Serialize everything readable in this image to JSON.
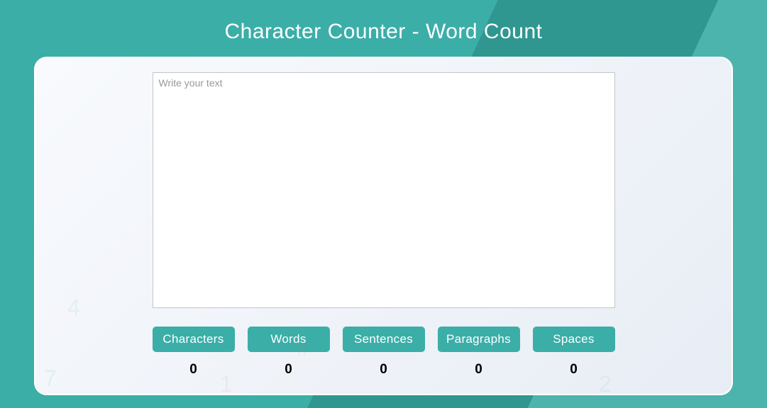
{
  "header": {
    "title": "Character Counter - Word Count"
  },
  "input": {
    "value": "",
    "placeholder": "Write your text"
  },
  "counters": [
    {
      "label": "Characters",
      "value": "0"
    },
    {
      "label": "Words",
      "value": "0"
    },
    {
      "label": "Sentences",
      "value": "0"
    },
    {
      "label": "Paragraphs",
      "value": "0"
    },
    {
      "label": "Spaces",
      "value": "0"
    }
  ],
  "colors": {
    "accent": "#3BAEA8",
    "accentDark": "#2F9690"
  }
}
